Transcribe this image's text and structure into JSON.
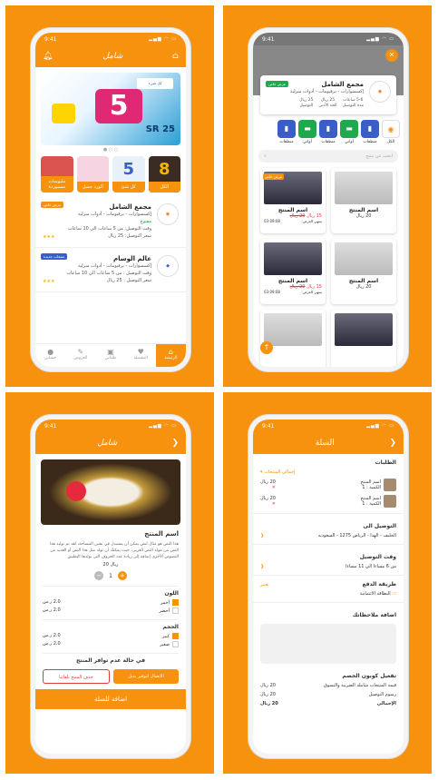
{
  "status_time": "9:41",
  "app_title": "شامل",
  "home": {
    "banner_big": "5",
    "banner_sr": "SR",
    "banner_price": "25",
    "banner_logo": "كل شيء",
    "categories": [
      {
        "label": "الكل",
        "glyph": "8"
      },
      {
        "label": "كل شئ",
        "glyph": "5"
      },
      {
        "label": "الورد جميل",
        "glyph": ""
      },
      {
        "label": "ملبوسات مستوردة",
        "glyph": ""
      }
    ],
    "stores": [
      {
        "name": "مجمع الشامل",
        "tags": "إكسسوارات - برفيومات - أدوات منزلية",
        "status": "مفتوح",
        "delivery_time": "وقت التوصيل: من 5 ساعات الي 10 ساعات",
        "delivery_price": "سعر التوصيل: 25 ريال",
        "badge": "عرض خاص"
      },
      {
        "name": "عالم الوسام",
        "tags": "إكسسوارات - برفيومات - أدوات منزلية",
        "status": "",
        "delivery_time": "وقت التوصيل : من 5 ساعات الي 10 ساعات",
        "delivery_price": "سعر التوصيل : 25 ريال",
        "badge": "منتجات جديدة"
      }
    ],
    "tabs": [
      "الرئيسة",
      "المفضلة",
      "طلباتي",
      "العروض",
      "حسابي"
    ]
  },
  "store": {
    "name": "مجمع الشامل",
    "tags": "إكسسوارات - برفيومات - أدوات منزلية",
    "badge": "عرض خاص",
    "meta": [
      {
        "v": "5-6 ساعات",
        "l": "مدة التوصيل"
      },
      {
        "v": "25 ريال",
        "l": "الحد الأدنى"
      },
      {
        "v": "25 ريال",
        "l": "التوصيل"
      }
    ],
    "chips": [
      "الكل",
      "منظفات",
      "أواني",
      "منظفات",
      "أواني",
      "منظفات"
    ],
    "search_placeholder": "ابحث عن منتج",
    "products": [
      {
        "name": "اسم المنتج",
        "price": "15 ريال",
        "old": "20 ريال",
        "ends_label": "ينتهي العرض:",
        "ends": "03:09:08",
        "offer": "عرض خاص"
      },
      {
        "name": "اسم المنتج",
        "price": "20 ريال"
      },
      {
        "name": "اسم المنتج",
        "price": "15 ريال",
        "old": "20 ريال",
        "ends_label": "ينتهي العرض:",
        "ends": "03:09:08",
        "offer": ""
      },
      {
        "name": "اسم المنتج",
        "price": "20 ريال"
      }
    ]
  },
  "product": {
    "title": "اسم المنتج",
    "desc": "هذا النص هو مثال لنص يمكن أن يستبدل في نفس المساحة، لقد تم توليد هذا النص من مولد النص العربى، حيث يمكنك أن تولد مثل هذا النص أو العديد من النصوص الأخرى إضافة إلى زيادة عدد الحروف التى يولدها التطبيق",
    "price": "20 ريال",
    "qty": "1",
    "color_title": "اللون",
    "colors": [
      {
        "n": "أحمر",
        "p": "2.0 ر.س",
        "on": true
      },
      {
        "n": "أخضر",
        "p": "2.0 ر.س",
        "on": false
      }
    ],
    "size_title": "الحجم",
    "sizes": [
      {
        "n": "كبير",
        "p": "2.0 ر.س",
        "on": true
      },
      {
        "n": "صغير",
        "p": "2.0 ر.س",
        "on": false
      }
    ],
    "unavailable": "في حالة عدم توافر المنتج",
    "btn_alt": "الاتصال لتوفير بديل",
    "btn_del": "حذف المنتج تلقائيا",
    "add_cart": "اضافة للسلة"
  },
  "cart": {
    "title": "السلة",
    "orders_title": "الطلبات",
    "store_label": "إجمالي المنتجات",
    "items": [
      {
        "name": "اسم المنتج",
        "qty": "الكمية : 1",
        "price": "20 ريال"
      },
      {
        "name": "اسم المنتج",
        "qty": "الكمية : 1",
        "price": "20 ريال"
      }
    ],
    "delivery_title": "التوصيل الى",
    "delivery_addr": "الخليف - الهدا - الرياض 1275 - السعودية",
    "time_title": "وقت التوصيل",
    "time_val": "من 6 مساءا الي 11 مساءا",
    "pay_title": "طريقة الدفع",
    "pay_change": "تغيير",
    "pay_val": "البطاقة الائتمانية",
    "note_title": "اضافة ملاحظاتك",
    "coupon_title": "تفعيل كوبون الخصم",
    "totals": [
      {
        "l": "قيمة المنتجات شاملة الضريبة والتسوق",
        "v": "20 ريال"
      },
      {
        "l": "رسوم التوصيل",
        "v": "20 ريال"
      },
      {
        "l": "الإجمالي",
        "v": "20 ريال"
      }
    ]
  },
  "watermark": "PhotoGrid"
}
